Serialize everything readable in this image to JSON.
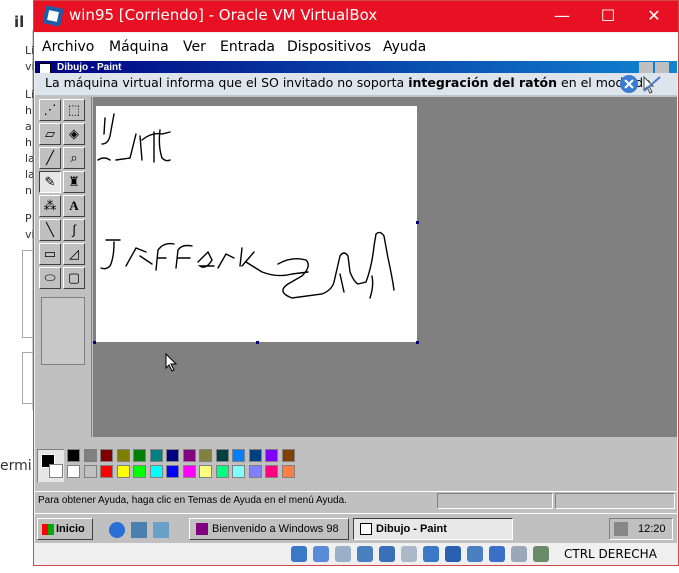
{
  "background": {
    "heading_fragment": "il",
    "frag1": "Li",
    "frag2": "vi",
    "frag3": "Li",
    "frag4": "h",
    "frag5": "a",
    "frag6": "h",
    "frag7": "la",
    "frag8": "la",
    "frag9": "n",
    "frag10": "P",
    "frag11": "vi",
    "bottom_fragment": "ermi"
  },
  "window": {
    "title": "win95 [Corriendo] - Oracle VM VirtualBox",
    "minimize": "—",
    "maximize": "☐",
    "close": "✕"
  },
  "menu": [
    "Archivo",
    "Máquina",
    "Ver",
    "Entrada",
    "Dispositivos",
    "Ayuda"
  ],
  "guest": {
    "paint_title": "Dibujo - Paint",
    "notice_pre": "La máquina virtual informa que el SO invitado no soporta ",
    "notice_bold": "integración del ratón",
    "notice_post": " en el modo de",
    "status_text": "Para obtener Ayuda, haga clic en Temas de Ayuda en el menú Ayuda.",
    "start": "Inicio",
    "task1": "Bienvenido a Windows 98",
    "task2": "Dibujo - Paint",
    "clock": "12:20"
  },
  "colors": {
    "accent": "#e81123",
    "win98_title": "#000080",
    "palette": [
      "#000000",
      "#808080",
      "#800000",
      "#808000",
      "#008000",
      "#008080",
      "#000080",
      "#800080",
      "#808040",
      "#004040",
      "#0080ff",
      "#004080",
      "#8000ff",
      "#804000",
      "#ffffff",
      "#c0c0c0",
      "#ff0000",
      "#ffff00",
      "#00ff00",
      "#00ffff",
      "#0000ff",
      "#ff00ff",
      "#ffff80",
      "#00ff80",
      "#80ffff",
      "#8080ff",
      "#ff0080",
      "#ff8040"
    ]
  },
  "vbox_status": {
    "host_key": "CTRL DERECHA"
  }
}
